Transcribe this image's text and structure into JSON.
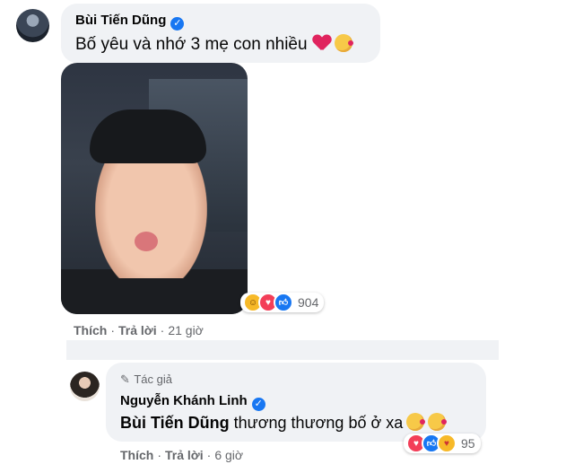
{
  "comment": {
    "author": "Bùi Tiến Dũng",
    "text": "Bố yêu và nhớ 3 mẹ con nhiều",
    "reactions": {
      "count": "904"
    },
    "actions": {
      "like": "Thích",
      "reply": "Trả lời",
      "separator": "·",
      "time": "21 giờ"
    }
  },
  "reply": {
    "author_tag": "Tác giả",
    "author": "Nguyễn Khánh Linh",
    "mention": "Bùi Tiến Dũng",
    "text": " thương thương bố ở xa",
    "reactions": {
      "count": "95"
    },
    "actions": {
      "like": "Thích",
      "reply": "Trả lời",
      "separator": "·",
      "time": "6 giờ"
    }
  },
  "colors": {
    "bubble": "#f0f2f5",
    "verified": "#1877f2",
    "meta": "#65676b"
  },
  "icons": [
    "verified-badge-icon",
    "red-heart-emoji",
    "kiss-emoji",
    "haha-reaction-icon",
    "love-reaction-icon",
    "like-reaction-icon",
    "care-reaction-icon",
    "pen-icon"
  ]
}
